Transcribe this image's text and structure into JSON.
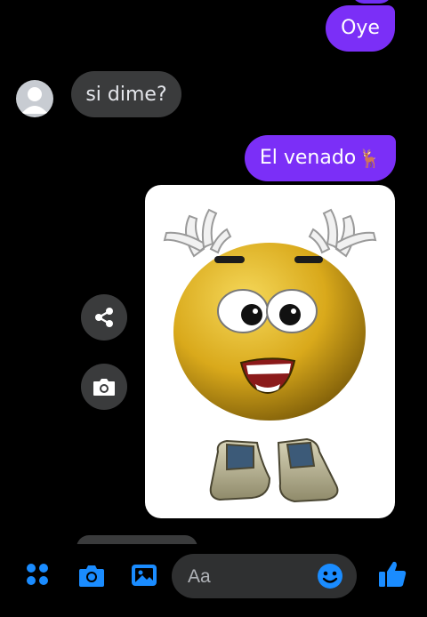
{
  "messages": {
    "outgoing_1": "Oye",
    "incoming_1": "si dime?",
    "outgoing_2": "El venado",
    "outgoing_2_emoji": "🦌"
  },
  "composer": {
    "placeholder": "Aa"
  },
  "colors": {
    "outgoing_bubble": "#7b2ff7",
    "incoming_bubble": "#3a3b3c",
    "accent_blue": "#1a8cff",
    "background": "#000000"
  },
  "icons": {
    "share": "share-icon",
    "camera": "camera-icon",
    "menu": "grid-dots-icon",
    "gallery": "gallery-icon",
    "emoji": "smiley-icon",
    "like": "thumbs-up-icon"
  }
}
